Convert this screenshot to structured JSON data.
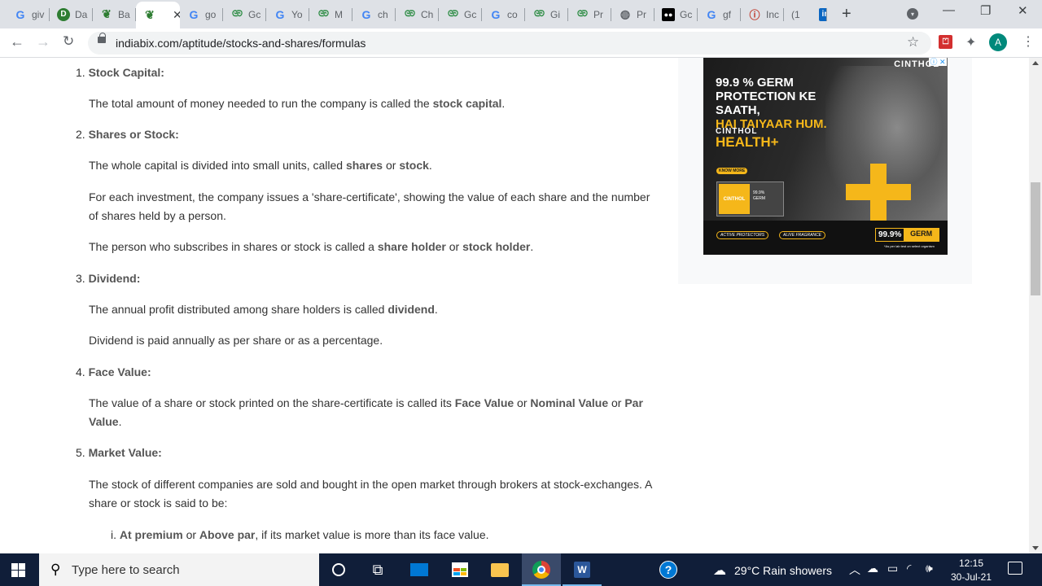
{
  "browser": {
    "tabs": [
      {
        "favicon": "google-icon",
        "title": "giv"
      },
      {
        "favicon": "ds-icon",
        "title": "Da"
      },
      {
        "favicon": "indiabix-icon",
        "title": "Ba"
      },
      {
        "favicon": "indiabix-icon",
        "title": "",
        "active": true
      },
      {
        "favicon": "google-icon",
        "title": "go"
      },
      {
        "favicon": "gfg-icon",
        "title": "Gc"
      },
      {
        "favicon": "google-icon",
        "title": "Yo"
      },
      {
        "favicon": "gfg-icon",
        "title": "M"
      },
      {
        "favicon": "google-icon",
        "title": "ch"
      },
      {
        "favicon": "gfg-icon",
        "title": "Ch"
      },
      {
        "favicon": "gfg-icon",
        "title": "Gc"
      },
      {
        "favicon": "google-icon",
        "title": "co"
      },
      {
        "favicon": "gfg-icon",
        "title": "Gi"
      },
      {
        "favicon": "gfg-icon",
        "title": "Pr"
      },
      {
        "favicon": "globe-icon",
        "title": "Pr"
      },
      {
        "favicon": "medium-icon",
        "title": "Gc"
      },
      {
        "favicon": "google-icon",
        "title": "gf"
      },
      {
        "favicon": "indeed-icon",
        "title": "Inc"
      },
      {
        "favicon": "linkedin-icon",
        "title": "(1"
      }
    ],
    "url": "indiabix.com/aptitude/stocks-and-shares/formulas",
    "profile_initial": "A"
  },
  "article": {
    "sections": [
      {
        "num": "1.",
        "heading": "Stock Capital:"
      },
      {
        "num": "2.",
        "heading": "Shares or Stock:"
      },
      {
        "num": "3.",
        "heading": "Dividend:"
      },
      {
        "num": "4.",
        "heading": "Face Value:"
      },
      {
        "num": "5.",
        "heading": "Market Value:"
      }
    ],
    "p1": {
      "pre": "The total amount of money needed to run the company is called the ",
      "b1": "stock capital",
      "post": "."
    },
    "p2": {
      "pre": "The whole capital is divided into small units, called ",
      "b1": "shares",
      "mid": " or ",
      "b2": "stock",
      "post": "."
    },
    "p3": {
      "line1": "For each investment, the company issues a 'share-certificate', showing the value of each share and the number",
      "line2": "of shares held by a person."
    },
    "p4": {
      "pre": "The person who subscribes in shares or stock is called a ",
      "b1": "share holder",
      "mid": " or ",
      "b2": "stock holder",
      "post": "."
    },
    "p5": {
      "pre": "The annual profit distributed among share holders is called ",
      "b1": "dividend",
      "post": "."
    },
    "p6": "Dividend is paid annually as per share or as a percentage.",
    "p7": {
      "pre": "The value of a share or stock printed on the share-certificate is called its ",
      "b1": "Face Value",
      "mid1": " or ",
      "b2": "Nominal Value",
      "mid2": " or ",
      "b3": "Par",
      "b4": "Value",
      "post": "."
    },
    "p8": {
      "line1": "The stock of different companies are sold and bought in the open market through brokers at stock-exchanges. A",
      "line2": "share or stock is said to be:"
    },
    "li1": {
      "num": "i.",
      "b1": "At premium",
      "mid": " or ",
      "b2": "Above par",
      "post": ", if its market value is more than its face value."
    }
  },
  "ad": {
    "brand_top": "CINTHOL",
    "close": "ⓘ ✕",
    "headline1": "99.9 % GERM",
    "headline2": "PROTECTION KE SAATH,",
    "headline3": "HAI TAIYAAR HUM.",
    "brand": "CINTHOL",
    "product": "HEALTH+",
    "cta": "KNOW MORE",
    "pack_brand": "CINTHOL",
    "pack_claim1": "99.9%",
    "pack_claim2": "GERM",
    "pill1": "ACTIVE PROTECTORS",
    "pill2": "ALIVE FRAGRANCE",
    "germ_pct": "99.9%",
    "germ_word": "GERM",
    "fine": "*As per lab test on select organism"
  },
  "taskbar": {
    "search_placeholder": "Type here to search",
    "weather": "29°C  Rain showers",
    "time": "12:15",
    "date": "30-Jul-21"
  }
}
